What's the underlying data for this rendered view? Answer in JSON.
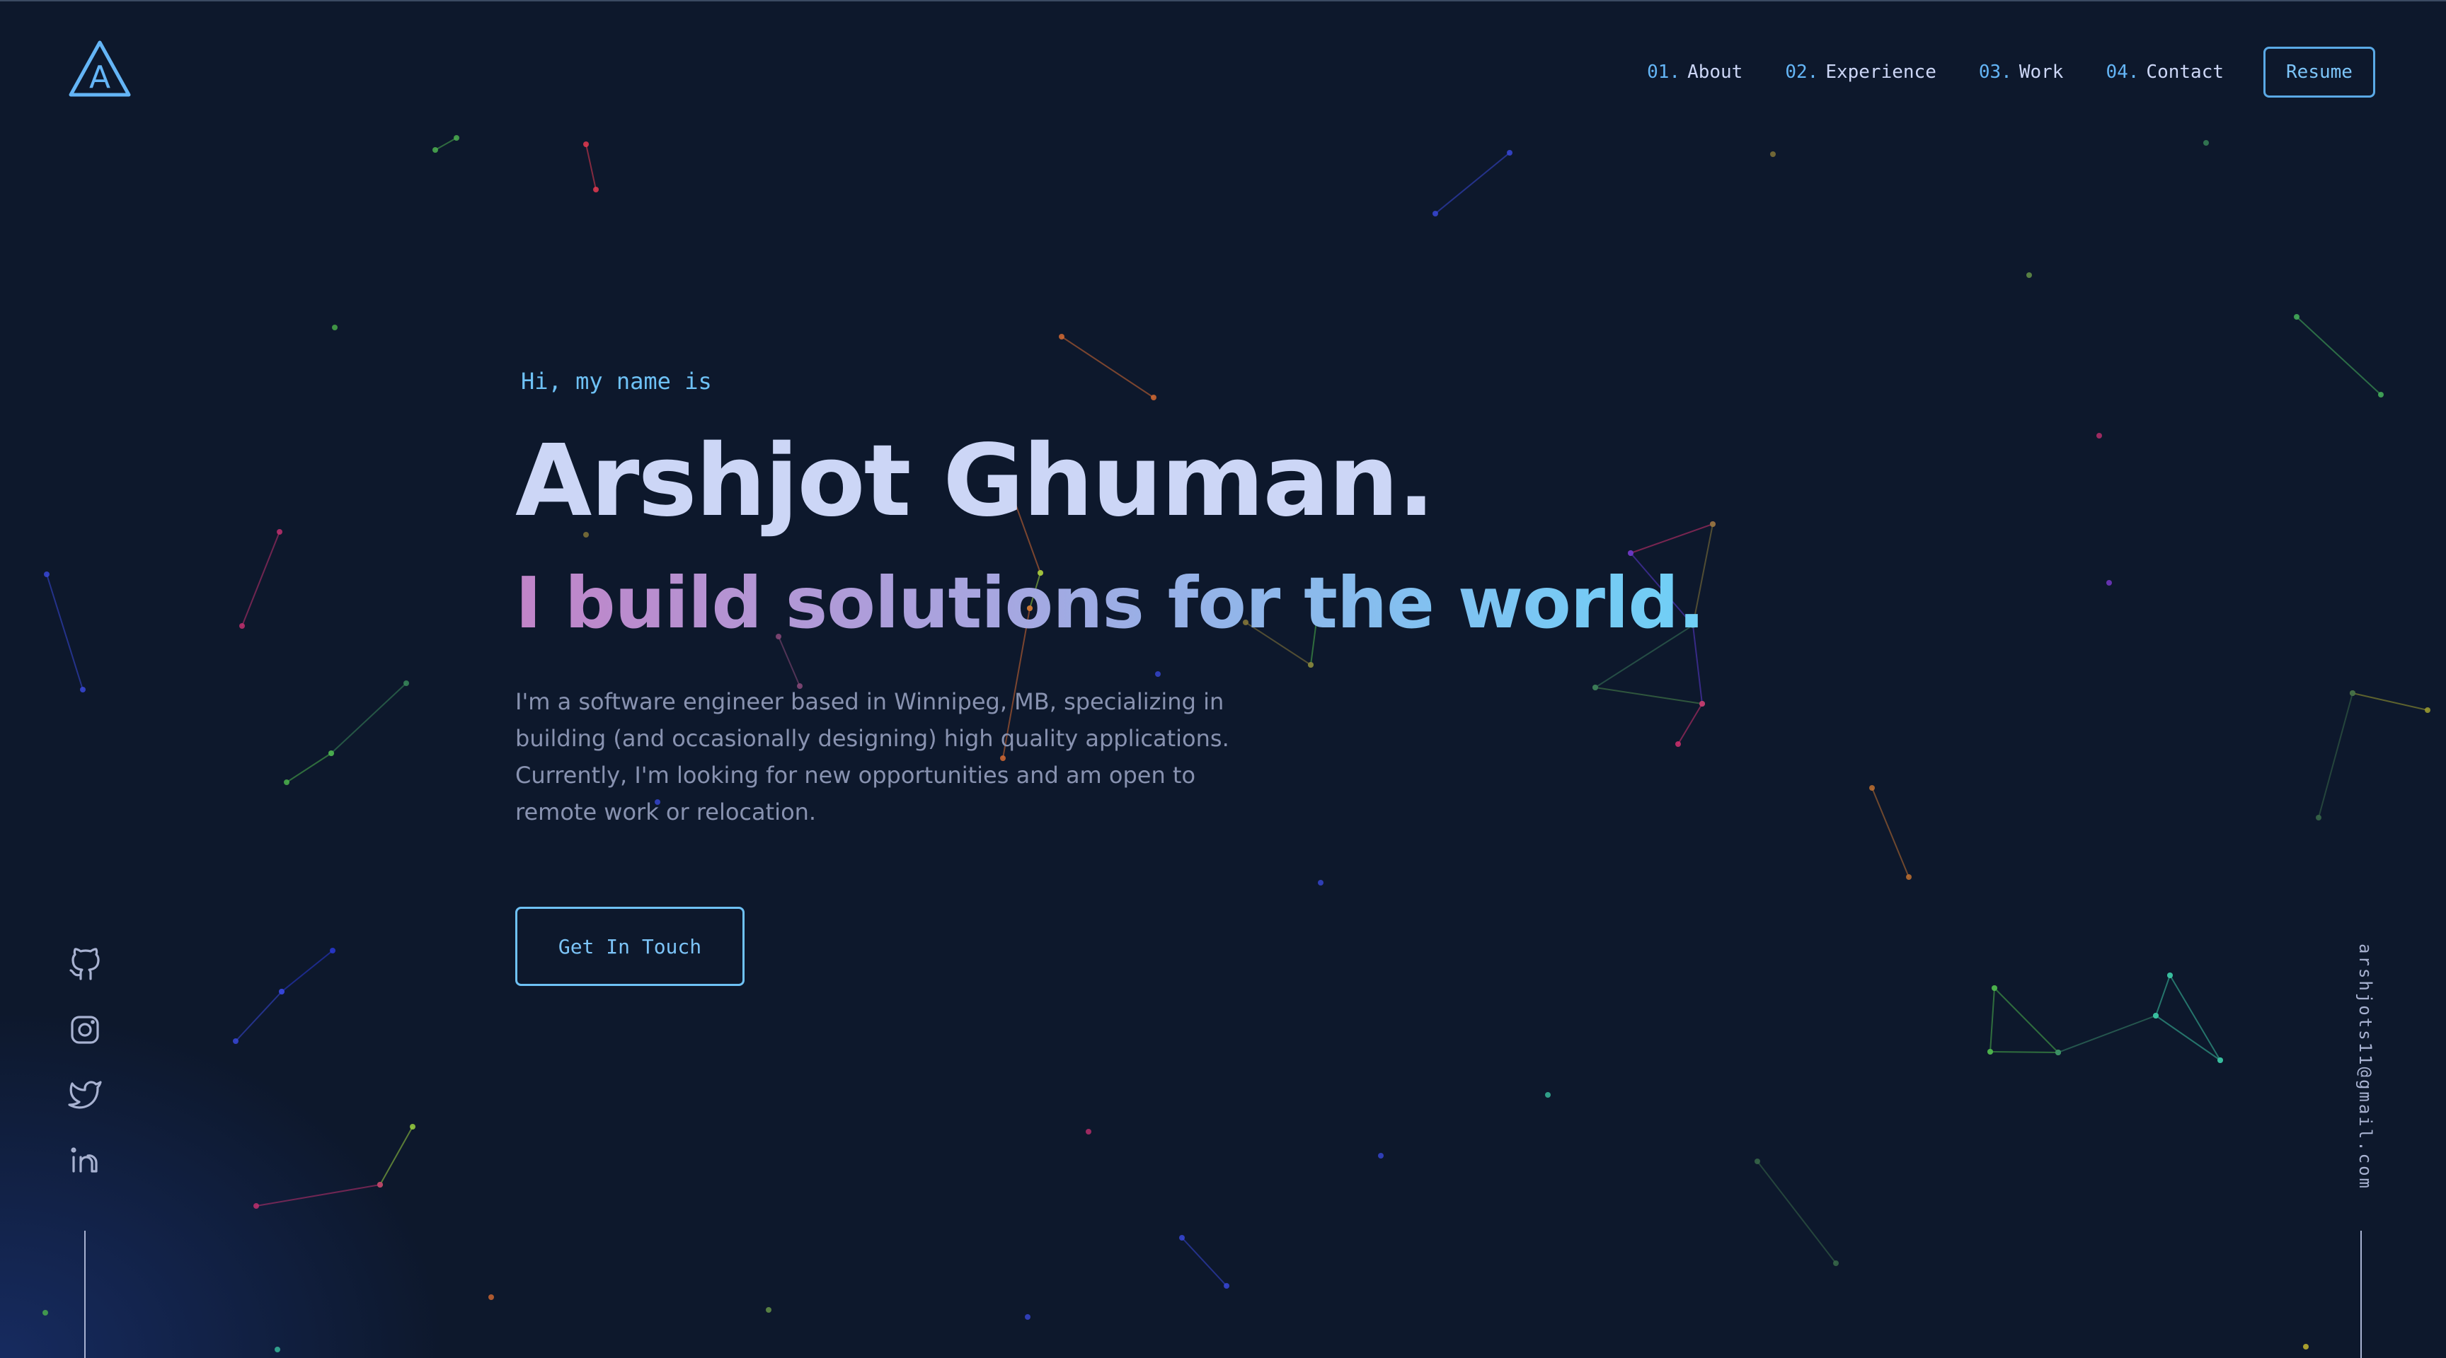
{
  "logo": {
    "letter": "A"
  },
  "nav": {
    "items": [
      {
        "num": "01.",
        "label": "About"
      },
      {
        "num": "02.",
        "label": "Experience"
      },
      {
        "num": "03.",
        "label": "Work"
      },
      {
        "num": "04.",
        "label": "Contact"
      }
    ],
    "resume_label": "Resume"
  },
  "hero": {
    "greeting": "Hi, my name is",
    "name": "Arshjot Ghuman.",
    "tagline": "I build solutions for the world.",
    "bio": "I'm a software engineer based in Winnipeg, MB, specializing in building (and occasionally designing) high quality applications. Currently, I'm looking for new opportunities and am open to remote work or relocation.",
    "cta_label": "Get In Touch"
  },
  "socials": [
    "github-icon",
    "instagram-icon",
    "twitter-icon",
    "linkedin-icon"
  ],
  "email": "arshjots11@gmail.com",
  "colors": {
    "background": "#0d182c",
    "accent": "#64b5f6",
    "heading": "#ccd6f6",
    "body_text": "#8892b0"
  }
}
